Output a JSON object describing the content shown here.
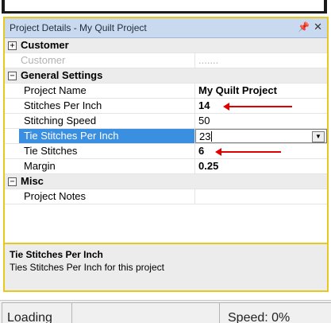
{
  "panel": {
    "title": "Project Details - My Quilt Project",
    "pin_glyph": "❙",
    "close_glyph": "✕",
    "pin_icon": "pin-icon",
    "close_icon": "close-icon"
  },
  "grid": {
    "categories": [
      {
        "name": "Customer",
        "expanded": false,
        "toggle": "+",
        "rows": [
          {
            "name": "Customer",
            "value": "......."
          }
        ]
      },
      {
        "name": "General Settings",
        "expanded": true,
        "toggle": "−",
        "rows": [
          {
            "name": "Project Name",
            "value": "My Quilt Project",
            "bold": true
          },
          {
            "name": "Stitches Per Inch",
            "value": "14",
            "bold": true
          },
          {
            "name": "Stitching Speed",
            "value": "50"
          },
          {
            "name": "Tie Stitches Per Inch",
            "value": "23",
            "selected": true
          },
          {
            "name": "Tie Stitches",
            "value": "6",
            "bold": true
          },
          {
            "name": "Margin",
            "value": "0.25",
            "bold": true
          }
        ]
      },
      {
        "name": "Misc",
        "expanded": true,
        "toggle": "−",
        "rows": [
          {
            "name": "Project Notes",
            "value": ""
          }
        ]
      }
    ],
    "dropdown_glyph": "▼",
    "annotation_color": "#e10000"
  },
  "description": {
    "heading": "Tie Stitches Per Inch",
    "text": "Ties Stitches Per Inch for this project"
  },
  "statusbar": {
    "left_text": "Loading",
    "right_text": "Speed: 0%"
  },
  "colors": {
    "panel_border": "#e6c820",
    "titlebar": "#c9daf0",
    "selection": "#3a8fe0"
  }
}
